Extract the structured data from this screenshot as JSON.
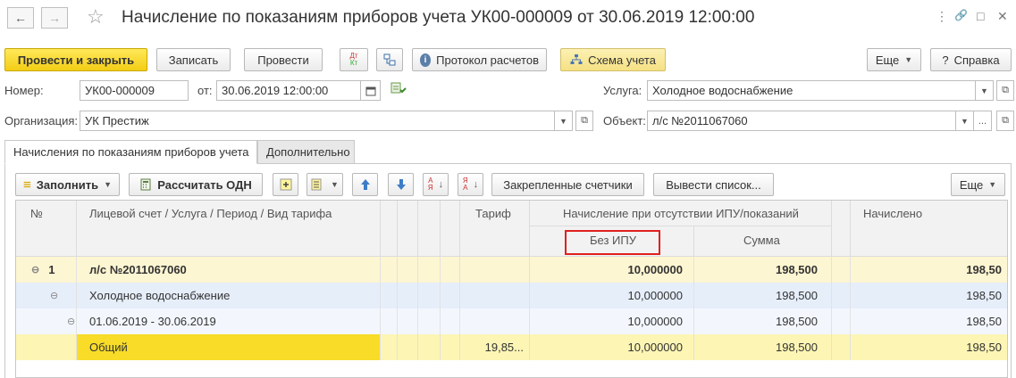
{
  "window": {
    "title": "Начисление по показаниям приборов учета УК00-000009 от 30.06.2019 12:00:00",
    "controls": [
      "⋮",
      "🔗",
      "□",
      "✕"
    ]
  },
  "nav": {
    "back": "←",
    "forward": "→",
    "star": "☆"
  },
  "toolbar": {
    "post_close": "Провести и закрыть",
    "save": "Записать",
    "post": "Провести",
    "dtkt": "ДтКт",
    "protocol": "Протокол расчетов",
    "scheme": "Схема учета",
    "more": "Еще",
    "help": "Справка",
    "help_icon": "?"
  },
  "form": {
    "number_label": "Номер:",
    "number_value": "УК00-000009",
    "date_label": "от:",
    "date_value": "30.06.2019 12:00:00",
    "org_label": "Организация:",
    "org_value": "УК Престиж",
    "service_label": "Услуга:",
    "service_value": "Холодное водоснабжение",
    "object_label": "Объект:",
    "object_value": "л/с №2011067060"
  },
  "tabs": [
    {
      "label": "Начисления по показаниям приборов учета"
    },
    {
      "label": "Дополнительно"
    }
  ],
  "table_toolbar": {
    "fill": "Заполнить",
    "calc_odn": "Рассчитать ОДН",
    "pinned_meters": "Закрепленные счетчики",
    "output_list": "Вывести список...",
    "more": "Еще"
  },
  "table": {
    "headers": {
      "num": "№",
      "account": "Лицевой счет / Услуга / Период / Вид тарифа",
      "tariff": "Тариф",
      "group": "Начисление при отсутствии ИПУ/показаний",
      "no_ipu": "Без ИПУ",
      "sum": "Сумма",
      "charged": "Начислено"
    },
    "rows": [
      {
        "num": "1",
        "tree": "⊖",
        "name": "л/с №2011067060",
        "tariff": "",
        "no_ipu": "10,000000",
        "sum": "198,500",
        "charged": "198,50",
        "bold": true
      },
      {
        "num": "",
        "tree": "⊖",
        "name": "Холодное водоснабжение",
        "tariff": "",
        "no_ipu": "10,000000",
        "sum": "198,500",
        "charged": "198,50"
      },
      {
        "num": "",
        "tree": "⊖",
        "name": "01.06.2019 - 30.06.2019",
        "tariff": "",
        "no_ipu": "10,000000",
        "sum": "198,500",
        "charged": "198,50"
      },
      {
        "num": "",
        "tree": "",
        "name": "Общий",
        "tariff": "19,85...",
        "no_ipu": "10,000000",
        "sum": "198,500",
        "charged": "198,50"
      }
    ]
  },
  "colors": {
    "primary": "#f5d21b",
    "row_level1": "#fdf6d2",
    "row_level2": "#e6eefa",
    "row_level3": "#f3f7fd",
    "row_selected": "#fcf5b4",
    "row_selected_cell": "#f8dc28",
    "highlight": "#e02020"
  }
}
